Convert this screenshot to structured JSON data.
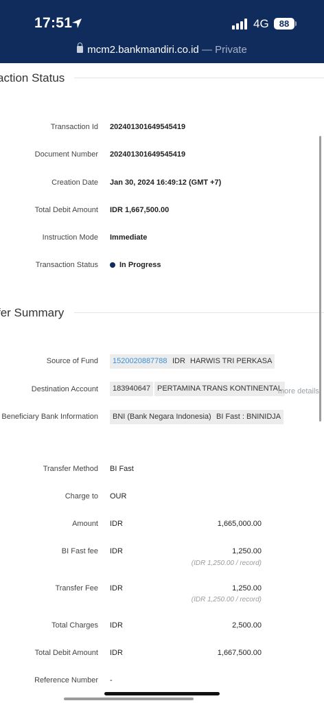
{
  "status_bar": {
    "time": "17:51",
    "network": "4G",
    "battery": "88"
  },
  "browser": {
    "url": "mcm2.bankmandiri.co.id",
    "mode": "— Private"
  },
  "transaction_status": {
    "title": "action Status",
    "rows": [
      {
        "label": "Transaction Id",
        "value": "202401301649545419"
      },
      {
        "label": "Document Number",
        "value": "202401301649545419"
      },
      {
        "label": "Creation Date",
        "value": "Jan 30, 2024 16:49:12 (GMT +7)"
      },
      {
        "label": "Total Debit Amount",
        "value": "IDR 1,667,500.00"
      },
      {
        "label": "Instruction Mode",
        "value": "Immediate"
      },
      {
        "label": "Transaction Status",
        "value": "In Progress"
      }
    ]
  },
  "transfer_summary": {
    "title": "fer Summary",
    "source_of_fund": {
      "label": "Source of Fund",
      "account": "1520020887788",
      "currency": "IDR",
      "name": "HARWIS TRI PERKASA"
    },
    "destination_account": {
      "label": "Destination Account",
      "account": "183940647",
      "name": "PERTAMINA TRANS KONTINENTAL",
      "more": "more details"
    },
    "beneficiary_bank": {
      "label": "Beneficiary Bank Information",
      "bank": "BNI (Bank Negara Indonesia)",
      "code": "BI Fast : BNINIDJA"
    },
    "transfer_method": {
      "label": "Transfer Method",
      "value": "BI Fast"
    },
    "charge_to": {
      "label": "Charge to",
      "value": "OUR"
    },
    "amount": {
      "label": "Amount",
      "currency": "IDR",
      "value": "1,665,000.00"
    },
    "bi_fast_fee": {
      "label": "BI Fast fee",
      "currency": "IDR",
      "value": "1,250.00",
      "per_record": "(IDR 1,250.00 / record)"
    },
    "transfer_fee": {
      "label": "Transfer Fee",
      "currency": "IDR",
      "value": "1,250.00",
      "per_record": "(IDR 1,250.00 / record)"
    },
    "total_charges": {
      "label": "Total Charges",
      "currency": "IDR",
      "value": "2,500.00"
    },
    "total_debit": {
      "label": "Total Debit Amount",
      "currency": "IDR",
      "value": "1,667,500.00"
    },
    "reference_number": {
      "label": "Reference Number",
      "value": "-"
    }
  }
}
